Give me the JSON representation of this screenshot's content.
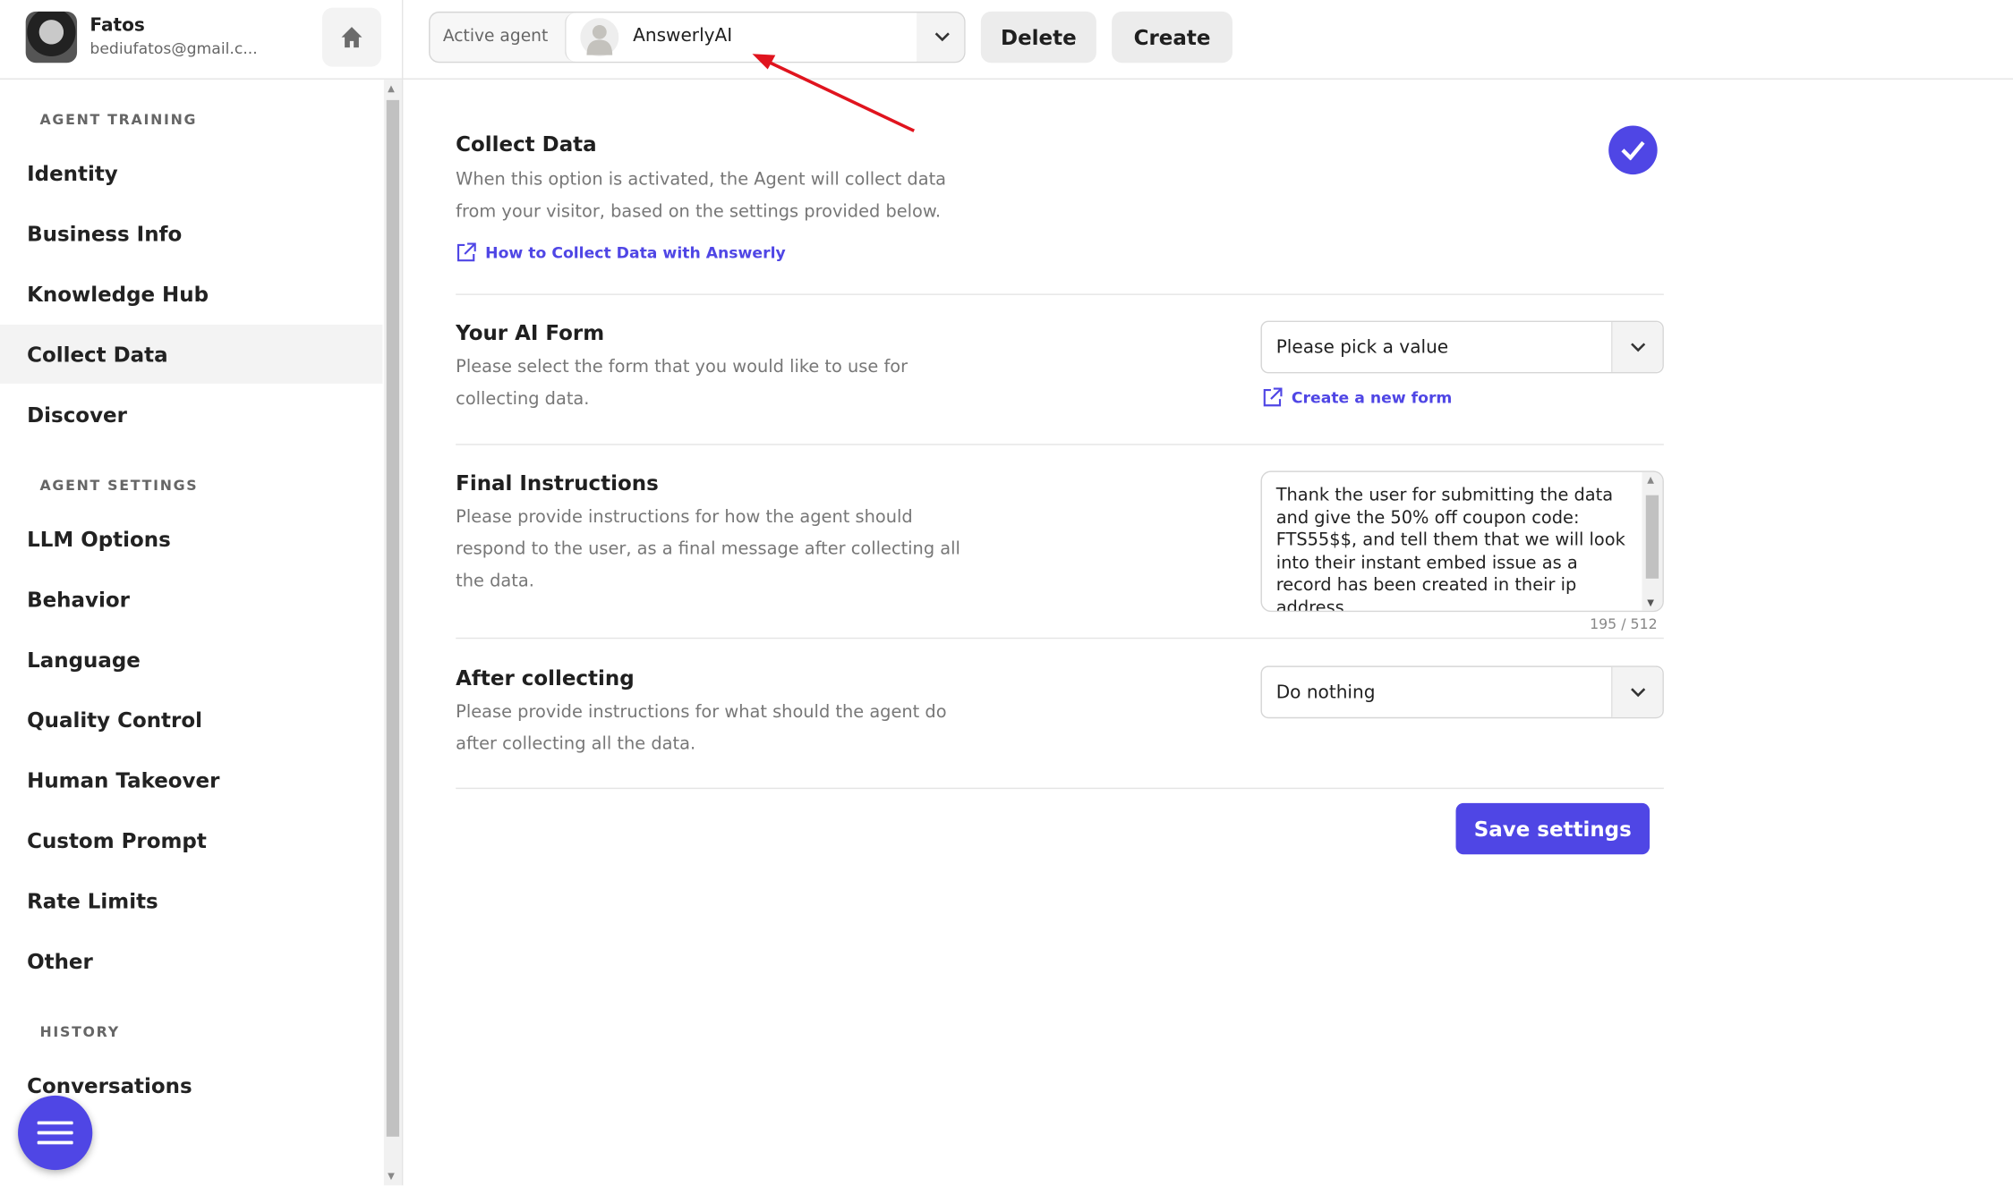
{
  "user": {
    "name": "Fatos",
    "email": "bediufatos@gmail.c..."
  },
  "sidebar": {
    "sections": [
      {
        "title": "AGENT TRAINING",
        "items": [
          "Identity",
          "Business Info",
          "Knowledge Hub",
          "Collect Data",
          "Discover"
        ]
      },
      {
        "title": "AGENT SETTINGS",
        "items": [
          "LLM Options",
          "Behavior",
          "Language",
          "Quality Control",
          "Human Takeover",
          "Custom Prompt",
          "Rate Limits",
          "Other"
        ]
      },
      {
        "title": "HISTORY",
        "items": [
          "Conversations"
        ]
      }
    ],
    "active": "Collect Data"
  },
  "header": {
    "active_agent_label": "Active agent",
    "agent": "AnswerlyAI",
    "delete": "Delete",
    "create": "Create"
  },
  "main": {
    "collect": {
      "title": "Collect Data",
      "desc": "When this option is activated, the Agent will collect data from your visitor, based on the settings provided below.",
      "link": "How to Collect Data with Answerly",
      "enabled": true
    },
    "form": {
      "title": "Your AI Form",
      "desc": "Please select the form that you would like to use for collecting data.",
      "select": "Please pick a value",
      "link": "Create a new form"
    },
    "final": {
      "title": "Final Instructions",
      "desc": "Please provide instructions for how the agent should respond to the user, as a final message after collecting all the data.",
      "value": "Thank the user for submitting the data and give the 50% off coupon code: FTS55$$, and tell them that we will look into their instant embed issue as a record has been created in their ip address",
      "counter": "195 / 512"
    },
    "after": {
      "title": "After collecting",
      "desc": "Please provide instructions for what should the agent do after collecting all the data.",
      "select": "Do nothing"
    },
    "save": "Save settings"
  },
  "colors": {
    "accent": "#4f46e5",
    "annotation_arrow": "#e0141e"
  }
}
